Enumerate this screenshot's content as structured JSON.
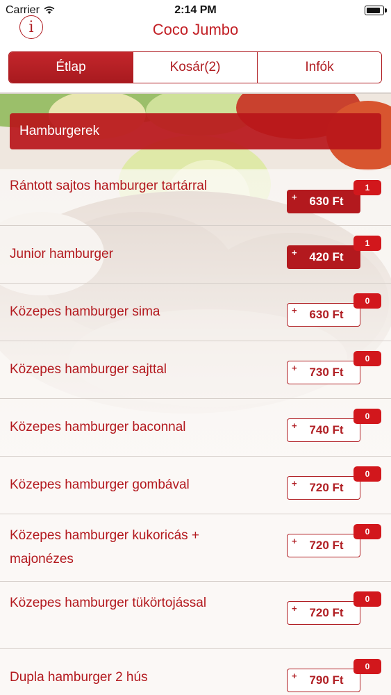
{
  "status_bar": {
    "carrier": "Carrier",
    "time": "2:14 PM",
    "battery_level": 0.95
  },
  "nav": {
    "title": "Coco Jumbo",
    "info_label": "i"
  },
  "tabs": [
    {
      "label": "Étlap",
      "active": true
    },
    {
      "label": "Kosár(2)",
      "active": false
    },
    {
      "label": "Infók",
      "active": false
    }
  ],
  "section": {
    "title": "Hamburgerek"
  },
  "items": [
    {
      "name": "Rántott sajtos hamburger tartárral",
      "price": "630 Ft",
      "plus": "+",
      "count": "1",
      "selected": true
    },
    {
      "name": "Junior hamburger",
      "price": "420 Ft",
      "plus": "+",
      "count": "1",
      "selected": true
    },
    {
      "name": "Közepes hamburger sima",
      "price": "630 Ft",
      "plus": "+",
      "count": "0",
      "selected": false
    },
    {
      "name": "Közepes hamburger sajttal",
      "price": "730 Ft",
      "plus": "+",
      "count": "0",
      "selected": false
    },
    {
      "name": "Közepes hamburger baconnal",
      "price": "740 Ft",
      "plus": "+",
      "count": "0",
      "selected": false
    },
    {
      "name": "Közepes hamburger gombával",
      "price": "720 Ft",
      "plus": "+",
      "count": "0",
      "selected": false
    },
    {
      "name": "Közepes hamburger kukoricás + majonézes",
      "price": "720 Ft",
      "plus": "+",
      "count": "0",
      "selected": false
    },
    {
      "name": "Közepes hamburger tükörtojással",
      "price": "720 Ft",
      "plus": "+",
      "count": "0",
      "selected": false
    },
    {
      "name": "Dupla hamburger 2 hús",
      "price": "790 Ft",
      "plus": "+",
      "count": "0",
      "selected": false
    }
  ]
}
